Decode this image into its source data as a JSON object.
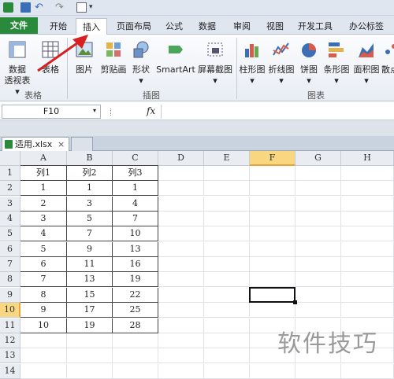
{
  "tabs": [
    "文件",
    "开始",
    "插入",
    "页面布局",
    "公式",
    "数据",
    "审阅",
    "视图",
    "开发工具",
    "办公标签"
  ],
  "ribbon": {
    "buttons": [
      {
        "l1": "数据",
        "l2": "透视表 ▾"
      },
      {
        "l1": "表格",
        "l2": ""
      },
      {
        "l1": "图片",
        "l2": ""
      },
      {
        "l1": "剪贴画",
        "l2": ""
      },
      {
        "l1": "形状",
        "l2": "▾"
      },
      {
        "l1": "SmartArt",
        "l2": ""
      },
      {
        "l1": "屏幕截图",
        "l2": "▾"
      },
      {
        "l1": "柱形图",
        "l2": "▾"
      },
      {
        "l1": "折线图",
        "l2": "▾"
      },
      {
        "l1": "饼图",
        "l2": "▾"
      },
      {
        "l1": "条形图",
        "l2": "▾"
      },
      {
        "l1": "面积图",
        "l2": "▾"
      },
      {
        "l1": "散点",
        "l2": ""
      }
    ],
    "groups": [
      "表格",
      "插图",
      "图表"
    ]
  },
  "namebox": "F10",
  "fx": "fx",
  "workbook_tab": "适用.xlsx",
  "close": "×",
  "columns": [
    "A",
    "B",
    "C",
    "D",
    "E",
    "F",
    "G",
    "H"
  ],
  "rows": [
    "1",
    "2",
    "3",
    "4",
    "5",
    "6",
    "7",
    "8",
    "9",
    "10",
    "11",
    "12",
    "13",
    "14"
  ],
  "table": [
    [
      "列1",
      "列2",
      "列3"
    ],
    [
      "1",
      "1",
      "1"
    ],
    [
      "2",
      "3",
      "4"
    ],
    [
      "3",
      "5",
      "7"
    ],
    [
      "4",
      "7",
      "10"
    ],
    [
      "5",
      "9",
      "13"
    ],
    [
      "6",
      "11",
      "16"
    ],
    [
      "7",
      "13",
      "19"
    ],
    [
      "8",
      "15",
      "22"
    ],
    [
      "9",
      "17",
      "25"
    ],
    [
      "10",
      "19",
      "28"
    ]
  ],
  "watermark": "软件技巧"
}
